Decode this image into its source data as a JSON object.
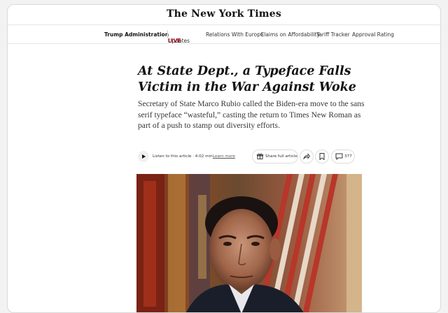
{
  "masthead": {
    "title": "The New York Times"
  },
  "nav": {
    "section": "Trump Administration",
    "live_label": "LIVE",
    "items": [
      "Updates",
      "Relations With Europe",
      "Claims on Affordability",
      "Tariff Tracker",
      "Approval Rating"
    ]
  },
  "article": {
    "headline": "At State Dept., a Typeface Falls Victim in the War Against Woke",
    "dek": "Secretary of State Marco Rubio called the Biden-era move to the sans serif typeface “wasteful,” casting the return to Times New Roman as part of a push to stamp out diversity efforts."
  },
  "audio": {
    "listen_text": "Listen to this article · 4:02 min",
    "learn_more": "Learn more"
  },
  "actions": {
    "share_label": "Share full article",
    "comment_count": "377"
  },
  "icons": [
    "play-icon",
    "gift-icon",
    "share-arrow-icon",
    "bookmark-icon",
    "comment-icon"
  ],
  "colors": {
    "live": "#d0021b"
  }
}
